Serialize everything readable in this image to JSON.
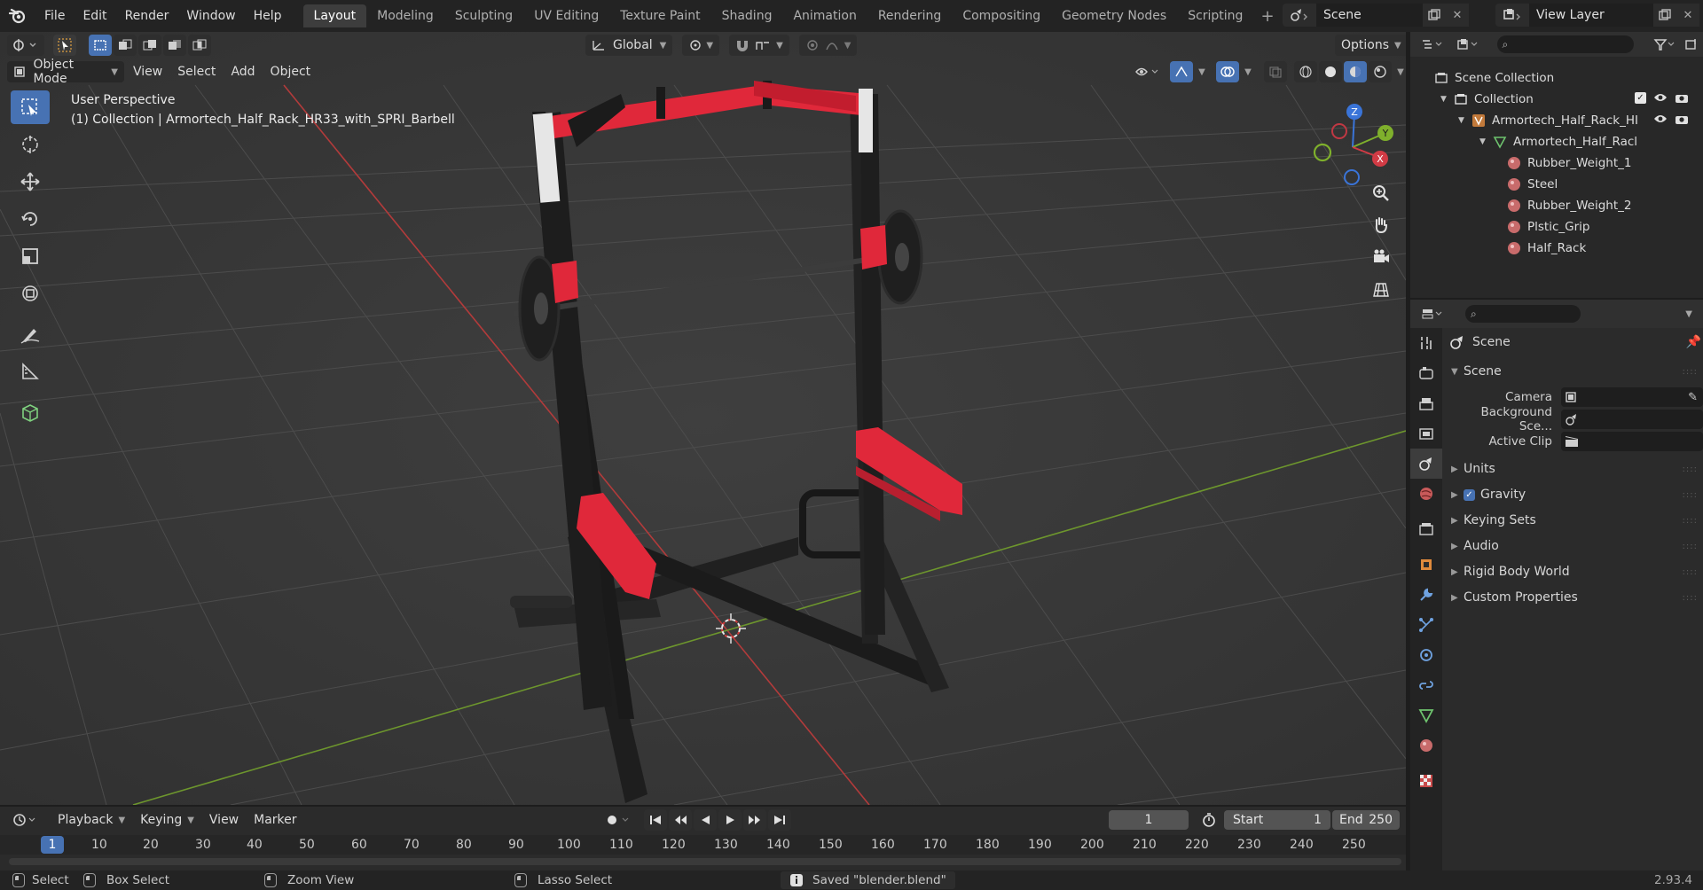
{
  "menu": {
    "items": [
      "File",
      "Edit",
      "Render",
      "Window",
      "Help"
    ]
  },
  "workspaces": {
    "tabs": [
      "Layout",
      "Modeling",
      "Sculpting",
      "UV Editing",
      "Texture Paint",
      "Shading",
      "Animation",
      "Rendering",
      "Compositing",
      "Geometry Nodes",
      "Scripting"
    ],
    "active": "Layout"
  },
  "scene_selector": {
    "value": "Scene"
  },
  "view_layer_selector": {
    "value": "View Layer"
  },
  "viewport": {
    "mode": "Object Mode",
    "menus": [
      "View",
      "Select",
      "Add",
      "Object"
    ],
    "orientation": "Global",
    "options_label": "Options",
    "info_line1": "User Perspective",
    "info_line2": "(1) Collection | Armortech_Half_Rack_HR33_with_SPRI_Barbell",
    "gizmo": {
      "z": "Z",
      "y": "Y",
      "x": "X"
    },
    "colors": {
      "background": "#393939",
      "grid": "#4a4a4a",
      "x_axis": "#b33c3c",
      "y_axis": "#6f9a2e",
      "rack_red": "#e0283a",
      "rack_black": "#1b1b1b"
    }
  },
  "outliner": {
    "rows": [
      {
        "label": "Scene Collection"
      },
      {
        "label": "Collection"
      },
      {
        "label": "Armortech_Half_Rack_HI"
      },
      {
        "label": "Armortech_Half_Racl"
      },
      {
        "label": "Rubber_Weight_1"
      },
      {
        "label": "Steel"
      },
      {
        "label": "Rubber_Weight_2"
      },
      {
        "label": "Plstic_Grip"
      },
      {
        "label": "Half_Rack"
      }
    ]
  },
  "properties": {
    "context_title": "Scene",
    "section": "Scene",
    "fields": {
      "camera_label": "Camera",
      "background_label": "Background Sce...",
      "active_clip_label": "Active Clip"
    },
    "panels": [
      "Units",
      "Gravity",
      "Keying Sets",
      "Audio",
      "Rigid Body World",
      "Custom Properties"
    ],
    "gravity_checked": true
  },
  "timeline": {
    "menus": [
      "Playback",
      "Keying",
      "View",
      "Marker"
    ],
    "current_frame": "1",
    "start_label": "Start",
    "start_value": "1",
    "end_label": "End",
    "end_value": "250",
    "ruler_current": "1",
    "ruler": [
      "10",
      "20",
      "30",
      "40",
      "50",
      "60",
      "70",
      "80",
      "90",
      "100",
      "110",
      "120",
      "130",
      "140",
      "150",
      "160",
      "170",
      "180",
      "190",
      "200",
      "210",
      "220",
      "230",
      "240",
      "250"
    ]
  },
  "statusbar": {
    "select": "Select",
    "box_select": "Box Select",
    "zoom_view": "Zoom View",
    "lasso_select": "Lasso Select",
    "message": "Saved \"blender.blend\"",
    "version": "2.93.4"
  }
}
